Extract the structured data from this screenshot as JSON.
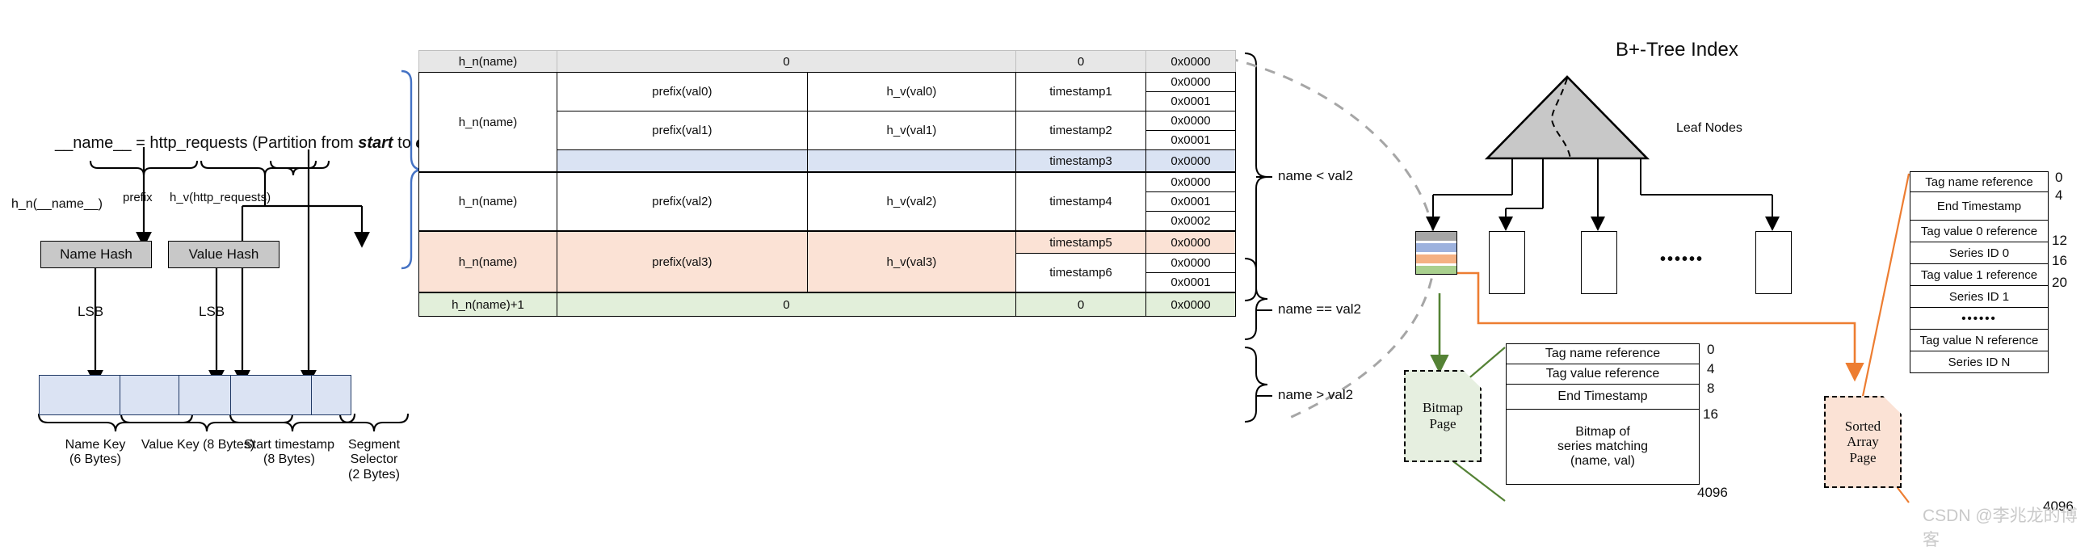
{
  "left_panel": {
    "title_parts": {
      "p1": "__name__ = http_requests (Partition from ",
      "start": "start",
      "mid": " to ",
      "end": "end",
      "close": ")"
    },
    "labels": {
      "h_n_name": "h_n(__name__)",
      "prefix": "prefix",
      "h_v_http_requests": "h_v(http_requests)",
      "lsb_left": "LSB",
      "lsb_right": "LSB"
    },
    "hash_boxes": [
      {
        "label": "Name Hash"
      },
      {
        "label": "Value Hash"
      }
    ],
    "key_segments": [
      {
        "label_line1": "Name Key",
        "label_line2": "(6 Bytes)"
      },
      {
        "label_line1": "Value Key (8 Bytes)",
        "label_line2": ""
      },
      {
        "label_line1": "Start timestamp",
        "label_line2": "(8 Bytes)"
      },
      {
        "label_line1": "Segment",
        "label_line2": "Selector",
        "label_line3": "(2 Bytes)"
      }
    ]
  },
  "index_table": {
    "header": [
      "h_n(name)",
      "0",
      "0",
      "0x0000"
    ],
    "footer": [
      "h_n(name)+1",
      "0",
      "0",
      "0x0000"
    ],
    "groups": [
      {
        "name_key": "h_n(name)",
        "highlight": "",
        "rows": [
          {
            "prefix": "prefix(val0)",
            "hv": "h_v(val0)",
            "timestamp": "timestamp1",
            "segments": [
              "0x0000",
              "0x0001"
            ],
            "highlight": ""
          },
          {
            "prefix": "prefix(val1)",
            "hv": "h_v(val1)",
            "timestamp": "timestamp2",
            "segments": [
              "0x0000",
              "0x0001"
            ],
            "highlight": ""
          },
          {
            "prefix": "",
            "hv": "",
            "timestamp": "timestamp3",
            "segments": [
              "0x0000"
            ],
            "highlight": "blue"
          }
        ]
      },
      {
        "name_key": "h_n(name)",
        "highlight": "",
        "rows": [
          {
            "prefix": "prefix(val2)",
            "hv": "h_v(val2)",
            "timestamp": "timestamp4",
            "segments": [
              "0x0000",
              "0x0001",
              "0x0002"
            ],
            "highlight": ""
          }
        ]
      },
      {
        "name_key": "h_n(name)",
        "highlight": "",
        "rows": [
          {
            "prefix": "",
            "hv": "",
            "timestamp": "timestamp5",
            "segments": [
              "0x0000"
            ],
            "highlight": "orange"
          },
          {
            "prefix": "prefix(val3)",
            "hv": "h_v(val3)",
            "timestamp": "timestamp6",
            "segments": [
              "0x0000",
              "0x0001"
            ],
            "highlight": ""
          }
        ]
      }
    ],
    "brace_labels": [
      {
        "text": "name < val2"
      },
      {
        "text": "name == val2"
      },
      {
        "text": "name > val2"
      }
    ]
  },
  "right_panel": {
    "tree_title": "B+-Tree Index",
    "leaf_nodes_label": "Leaf Nodes",
    "ellipsis": "••••••",
    "bitmap_page": {
      "label_line1": "Bitmap",
      "label_line2": "Page",
      "rows": [
        "Tag name reference",
        "Tag value reference",
        "End Timestamp",
        "Bitmap of|series matching|(name, val)"
      ],
      "offsets": [
        "0",
        "4",
        "8",
        "16",
        "4096"
      ]
    },
    "sorted_array_page": {
      "label_line1": "Sorted",
      "label_line2": "Array",
      "label_line3": "Page",
      "rows": [
        "Tag name reference",
        "End Timestamp",
        "Tag value 0 reference",
        "Series ID 0",
        "Tag value 1 reference",
        "Series ID 1",
        "••••••",
        "Tag value N reference",
        "Series ID N"
      ],
      "offsets": [
        "0",
        "4",
        "12",
        "16",
        "20",
        "4096"
      ]
    }
  },
  "watermark": "CSDN @李兆龙的博客",
  "colors": {
    "blue_fill": "#dae3f3",
    "orange_fill": "#fbe2d5",
    "green_fill": "#e2efda",
    "gray_fill": "#c8c8c8",
    "header_gray": "#e7e7e7",
    "orange_line": "#ed7d31",
    "green_line": "#548235",
    "blue_brace": "#4472c4",
    "dash_gray": "#a6a6a6"
  }
}
